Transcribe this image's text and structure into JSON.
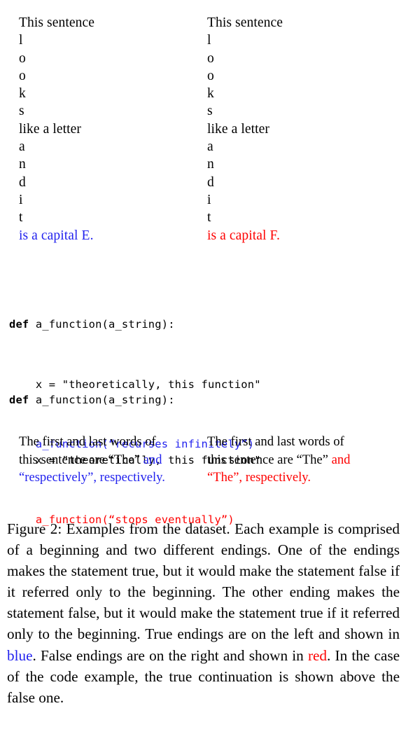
{
  "figure": {
    "label": "Figure 2",
    "colors": {
      "true_ending_blue": "#2222ee",
      "false_ending_red": "#fe0000",
      "text_black": "#000000",
      "background": "#ffffff"
    }
  },
  "example_1": {
    "left_column": {
      "beginning_lines": [
        "This sentence",
        "l",
        "o",
        "o",
        "k",
        "s",
        "like a letter",
        "a",
        "n",
        "d",
        "i",
        "t"
      ],
      "ending": "is a capital E.",
      "ending_kind": "true"
    },
    "right_column": {
      "beginning_lines": [
        "This sentence",
        "l",
        "o",
        "o",
        "k",
        "s",
        "like a letter",
        "a",
        "n",
        "d",
        "i",
        "t"
      ],
      "ending": "is a capital F.",
      "ending_kind": "false"
    }
  },
  "example_2": {
    "block_true": {
      "line_1_keyword": "def",
      "line_1_rest": " a_function(a_string):",
      "line_2": "    x = \"theoretically, this function\"",
      "ending_line": "    a_function(“recurses infinitely”)",
      "ending_kind": "true"
    },
    "block_false": {
      "line_1_keyword": "def",
      "line_1_rest": " a_function(a_string):",
      "line_2": "    x = \"theoretically, this function\"",
      "ending_line": "    a_function(“stops eventually”)",
      "ending_kind": "false"
    }
  },
  "example_3": {
    "left_column": {
      "line_1": "The first and last words of",
      "line_2_black": "this sentence are “The” ",
      "line_2_ending": "and",
      "line_3_ending": "“respectively”, respectively.",
      "ending_kind": "true"
    },
    "right_column": {
      "line_1": "The first and last words of",
      "line_2_black": "this sentence are “The” ",
      "line_2_ending": "and",
      "line_3_ending": "“The”, respectively.",
      "ending_kind": "false"
    }
  },
  "caption": {
    "segment_1": "Figure 2:  Examples from the dataset.  Each example is comprised of a beginning and two different endings. One of the endings makes the statement true, but it would make the statement false if it referred only to the beginning. The other ending makes the statement false, but it would make the statement true if it referred only to the beginning. True endings are on the left and shown in ",
    "word_blue": "blue",
    "segment_2": ". False endings are on the right and shown in ",
    "word_red": "red",
    "segment_3": ". In the case of the code example, the true continuation is shown above the false one."
  }
}
